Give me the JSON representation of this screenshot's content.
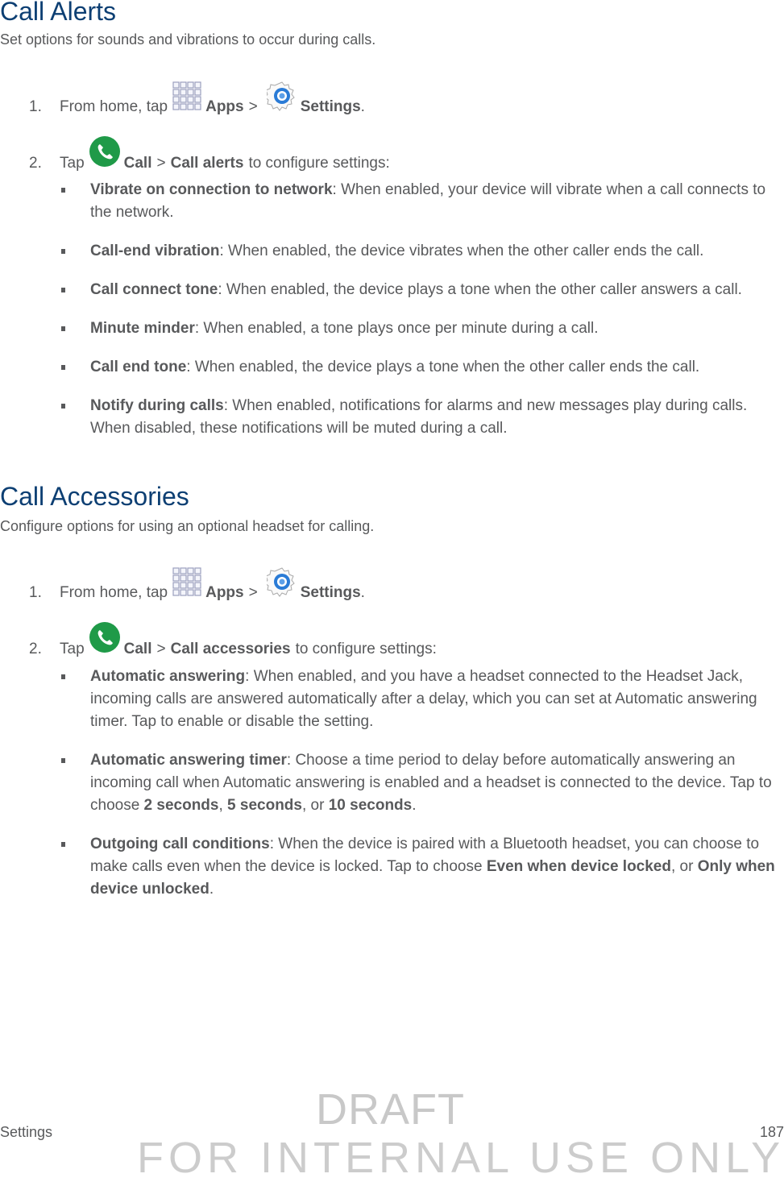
{
  "sections": [
    {
      "title": "Call Alerts",
      "intro": "Set options for sounds and vibrations to occur during calls.",
      "steps": [
        {
          "num": "1.",
          "pre": "From home, tap",
          "icon1": "apps-grid-icon",
          "label1": "Apps",
          "sep": ">",
          "icon2": "settings-gear-icon",
          "label2": "Settings",
          "post": "."
        },
        {
          "num": "2.",
          "pre": "Tap",
          "icon1": "phone-call-icon",
          "label1": "Call",
          "sep": ">",
          "label2": "Call alerts",
          "post": "to configure settings:"
        }
      ],
      "bullets": [
        {
          "term": "Vibrate on connection to network",
          "text": ": When enabled, your device will vibrate when a call connects to the network."
        },
        {
          "term": "Call-end vibration",
          "text": ": When enabled, the device vibrates when the other caller ends the call."
        },
        {
          "term": "Call connect tone",
          "text": ": When enabled, the device plays a tone when the other caller answers a call."
        },
        {
          "term": "Minute minder",
          "text": ": When enabled, a tone plays once per minute during a call."
        },
        {
          "term": "Call end tone",
          "text": ": When enabled, the device plays a tone when the other caller ends the call."
        },
        {
          "term": "Notify during calls",
          "text": ": When enabled, notifications for alarms and new messages play during calls. When disabled, these notifications will be muted during a call."
        }
      ]
    },
    {
      "title": "Call Accessories",
      "intro": "Configure options for using an optional headset for calling.",
      "steps": [
        {
          "num": "1.",
          "pre": "From home, tap",
          "icon1": "apps-grid-icon",
          "label1": "Apps",
          "sep": ">",
          "icon2": "settings-gear-icon",
          "label2": "Settings",
          "post": "."
        },
        {
          "num": "2.",
          "pre": "Tap",
          "icon1": "phone-call-icon",
          "label1": "Call",
          "sep": ">",
          "label2": "Call accessories",
          "post": "to configure settings:"
        }
      ],
      "bullets": [
        {
          "term": "Automatic answering",
          "text": ": When enabled, and you have a headset connected to the Headset Jack, incoming calls are answered automatically after a delay, which you can set at Automatic answering timer. Tap to enable or disable the setting."
        },
        {
          "term": "Automatic answering timer",
          "text": ": Choose a time period to delay before automatically answering an incoming call when Automatic answering is enabled and a headset is connected to the device. Tap to choose ",
          "opt1": "2 seconds",
          "sep1": ", ",
          "opt2": "5 seconds",
          "sep2": ", or ",
          "opt3": "10 seconds",
          "end": "."
        },
        {
          "term": "Outgoing call conditions",
          "text": ": When the device is paired with a Bluetooth headset, you can choose to make calls even when the device is locked. Tap to choose ",
          "opt1": "Even when device locked",
          "sep1": ", or ",
          "opt2": "Only when device unlocked",
          "end": "."
        }
      ]
    }
  ],
  "footer": {
    "section": "Settings",
    "page": "187"
  },
  "watermark": {
    "line1": "DRAFT",
    "line2": "FOR INTERNAL USE ONLY"
  },
  "colors": {
    "heading": "#0d3f73",
    "body": "#58595b",
    "call_green": "#1f9a48",
    "settings_blue": "#2a7bd6",
    "watermark": "#c8c8c8"
  }
}
